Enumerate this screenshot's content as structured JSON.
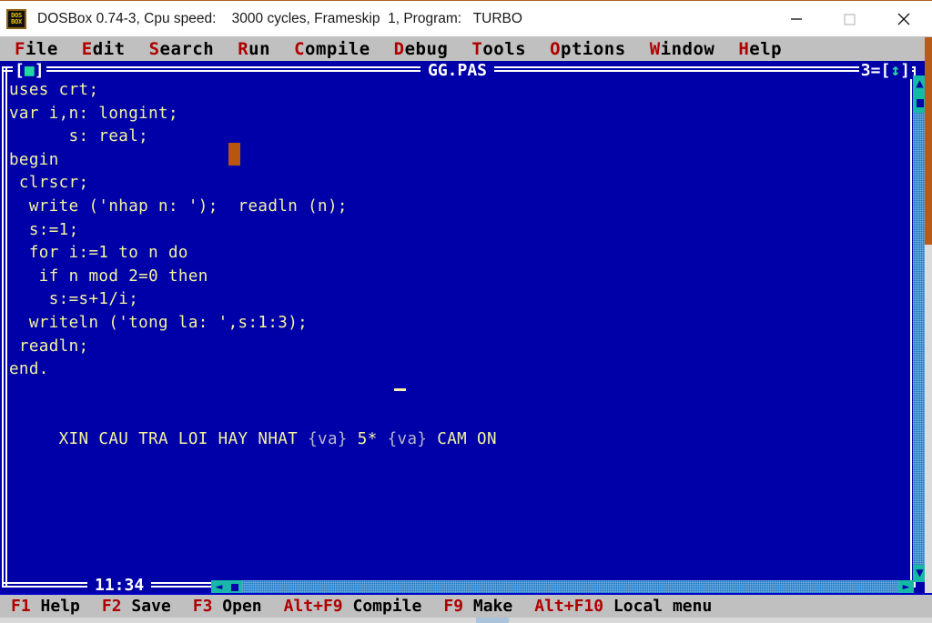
{
  "window": {
    "app_icon_line1": "DOS",
    "app_icon_line2": "BOX",
    "title": "DOSBox 0.74-3, Cpu speed:    3000 cycles, Frameskip  1, Program:   TURBO",
    "minimize_label": "minimize-icon",
    "maximize_label": "maximize-icon",
    "close_label": "close-icon"
  },
  "menubar": {
    "items": [
      {
        "hot": "F",
        "rest": "ile"
      },
      {
        "hot": "E",
        "rest": "dit"
      },
      {
        "hot": "S",
        "rest": "earch"
      },
      {
        "hot": "R",
        "rest": "un"
      },
      {
        "hot": "C",
        "rest": "ompile"
      },
      {
        "hot": "D",
        "rest": "ebug"
      },
      {
        "hot": "T",
        "rest": "ools"
      },
      {
        "hot": "O",
        "rest": "ptions"
      },
      {
        "hot": "W",
        "rest": "indow"
      },
      {
        "hot": "H",
        "rest": "elp"
      }
    ]
  },
  "editor": {
    "close_box_left": "[",
    "close_box_square": "■",
    "close_box_right": "]",
    "filename": "GG.PAS",
    "window_number": "3=[",
    "window_resize_arrow": "↕",
    "window_number_end": "]",
    "cursor_position": "11:34",
    "code_lines": [
      "uses crt;",
      "var i,n: longint;",
      "      s: real;",
      "begin",
      " clrscr;",
      "  write ('nhap n: ');  readln (n);",
      "  s:=1;",
      "  for i:=1 to n do",
      "   if n mod 2=0 then",
      "    s:=s+1/i;",
      "  writeln ('tong la: ',s:1:3);",
      " readln;",
      "end."
    ],
    "message_prefix": "     XIN CAU TRA LOI HAY NHAT ",
    "message_comment_1": "{va}",
    "message_mid": " 5* ",
    "message_comment_2": "{va}",
    "message_suffix": " CAM ON",
    "scroll_up_glyph": "▲",
    "scroll_down_glyph": "▼",
    "scroll_left_glyph": "◄",
    "scroll_right_glyph": "►"
  },
  "statusbar": {
    "items": [
      {
        "key": "F1",
        "label": " Help"
      },
      {
        "key": "F2",
        "label": " Save"
      },
      {
        "key": "F3",
        "label": " Open"
      },
      {
        "key": "Alt+F9",
        "label": " Compile"
      },
      {
        "key": "F9",
        "label": " Make"
      },
      {
        "key": "Alt+F10",
        "label": " Local menu"
      }
    ]
  },
  "colors": {
    "dos_blue": "#0000a8",
    "code_yellow": "#f4f4a0",
    "comment_gray": "#b8b8c8",
    "scrollbar_cyan": "#18b8a8",
    "cursor_orange": "#b85610",
    "hotkey_red": "#b00000"
  }
}
